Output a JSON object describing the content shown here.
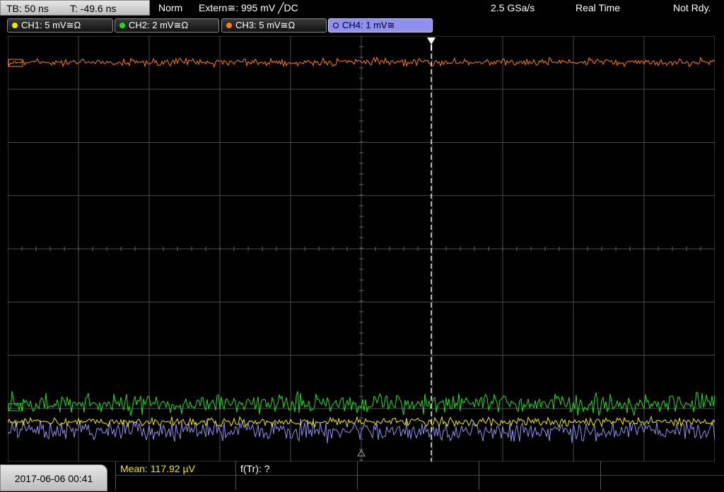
{
  "topbar": {
    "timebase": "TB: 50 ns",
    "trigger_time": "T: -49.6 ns",
    "trigger_mode": "Norm",
    "trigger_source": "Extern≅: 995 mV ╱DC",
    "sample_rate": "2.5 GSa/s",
    "acq_mode": "Real Time",
    "status": "Not Rdy."
  },
  "channels": [
    {
      "label": "CH1: 5 mV≅Ω",
      "color": "#f5e600"
    },
    {
      "label": "CH2: 2 mV≅Ω",
      "color": "#22dd22"
    },
    {
      "label": "CH3: 5 mV≅Ω",
      "color": "#ff7a1a"
    },
    {
      "label": "CH4: 1 mV≅",
      "color": "#8f8fef"
    }
  ],
  "bottombar": {
    "datetime": "2017-06-06 00:41",
    "mean": "Mean: 117.92 µV",
    "freq": "f(Tr): ?"
  },
  "colors": {
    "ch1": "#f5e600",
    "ch2": "#22dd22",
    "ch3": "#ff7a1a",
    "ch4": "#8f8fef",
    "grid": "#4a4a4a"
  }
}
